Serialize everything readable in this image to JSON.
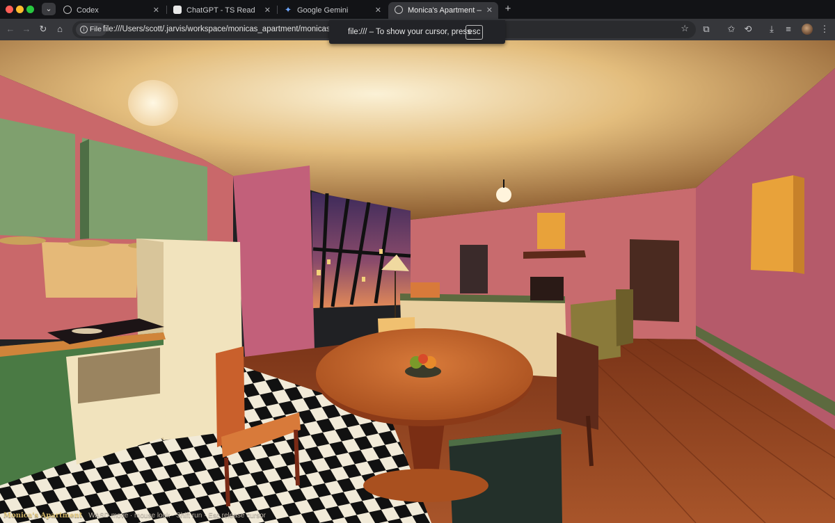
{
  "browser": {
    "tabs": [
      {
        "title": "Codex",
        "icon": "codex-icon"
      },
      {
        "title": "ChatGPT - TS Read",
        "icon": "chatgpt-icon"
      },
      {
        "title": "Google Gemini",
        "icon": "gemini-icon"
      },
      {
        "title": "Monica's Apartment — First P",
        "icon": "globe-icon",
        "active": true
      }
    ],
    "new_tab_label": "+",
    "address": {
      "chip_label": "File",
      "url": "file:///Users/scott/.jarvis/workspace/monicas_apartment/monicas_apartme"
    }
  },
  "fullscreen_toast": {
    "text": "file:/// – To show your cursor, press",
    "key": "esc"
  },
  "hud": {
    "title": "Monica's Apartment",
    "instructions": "WASD move · mouse look · Shift run · Esc release cursor"
  },
  "colors": {
    "wall_pink": "#c9686a",
    "ceiling": "#e9c98a",
    "floor_wood": "#9a4a22",
    "cabinet_green": "#7fa06e",
    "accent_yellow": "#e8a23a"
  }
}
